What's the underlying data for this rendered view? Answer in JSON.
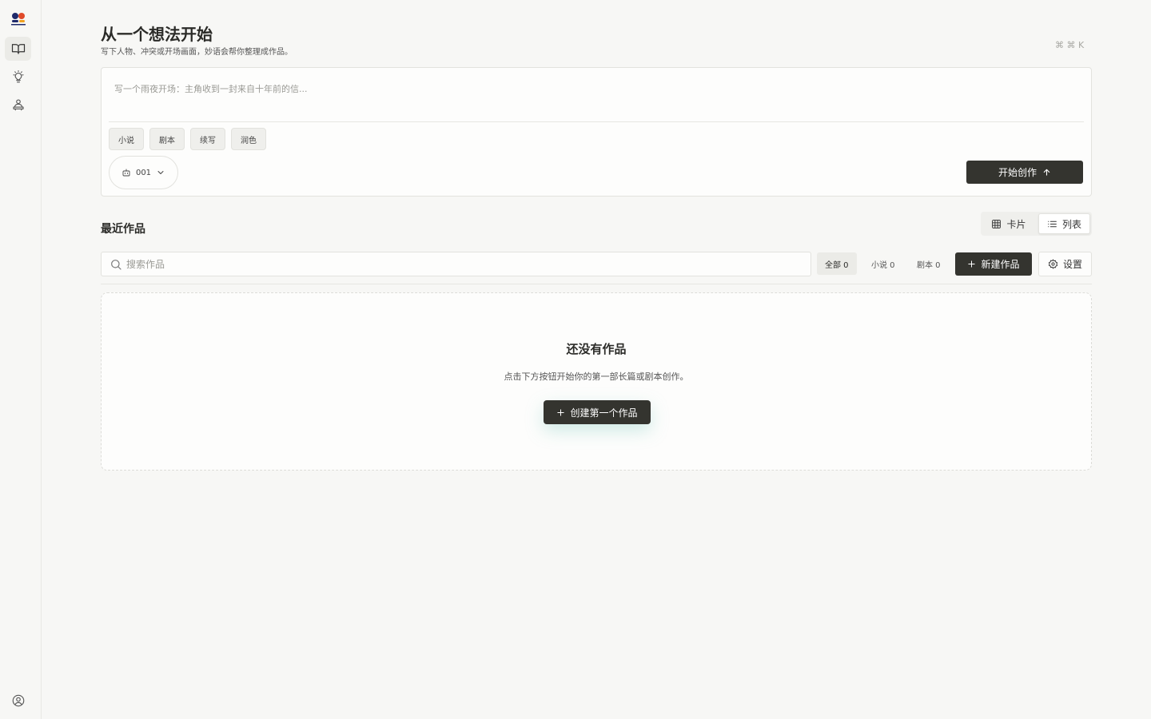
{
  "sidebar": {
    "items": [
      {
        "icon": "book-open-icon",
        "active": true
      },
      {
        "icon": "lightbulb-icon",
        "active": false
      },
      {
        "icon": "writer-icon",
        "active": false
      }
    ],
    "profile_icon": "user-circle-icon"
  },
  "header": {
    "title": "从一个想法开始",
    "subtitle": "写下人物、冲突或开场画面，妙语会帮你整理成作品。",
    "shortcut": "⌘ ⌘ K"
  },
  "composer": {
    "placeholder": "写一个雨夜开场：主角收到一封来自十年前的信...",
    "value": "",
    "chips": [
      "小说",
      "剧本",
      "续写",
      "润色"
    ],
    "model": "001",
    "start_label": "开始创作"
  },
  "recent": {
    "title": "最近作品",
    "view_card_label": "卡片",
    "view_list_label": "列表",
    "active_view": "列表",
    "search_placeholder": "搜索作品",
    "filters": [
      "全部 0",
      "小说 0",
      "剧本 0"
    ],
    "active_filter": "全部 0",
    "new_label": "新建作品",
    "settings_label": "设置"
  },
  "empty": {
    "title": "还没有作品",
    "description": "点击下方按钮开始你的第一部长篇或剧本创作。",
    "button_label": "创建第一个作品"
  },
  "colors": {
    "background": "#f7f7f5",
    "primary_button": "#34342f",
    "logo_red": "#e04a2a",
    "logo_navy": "#1f2a6b",
    "logo_amber": "#f0a020"
  }
}
